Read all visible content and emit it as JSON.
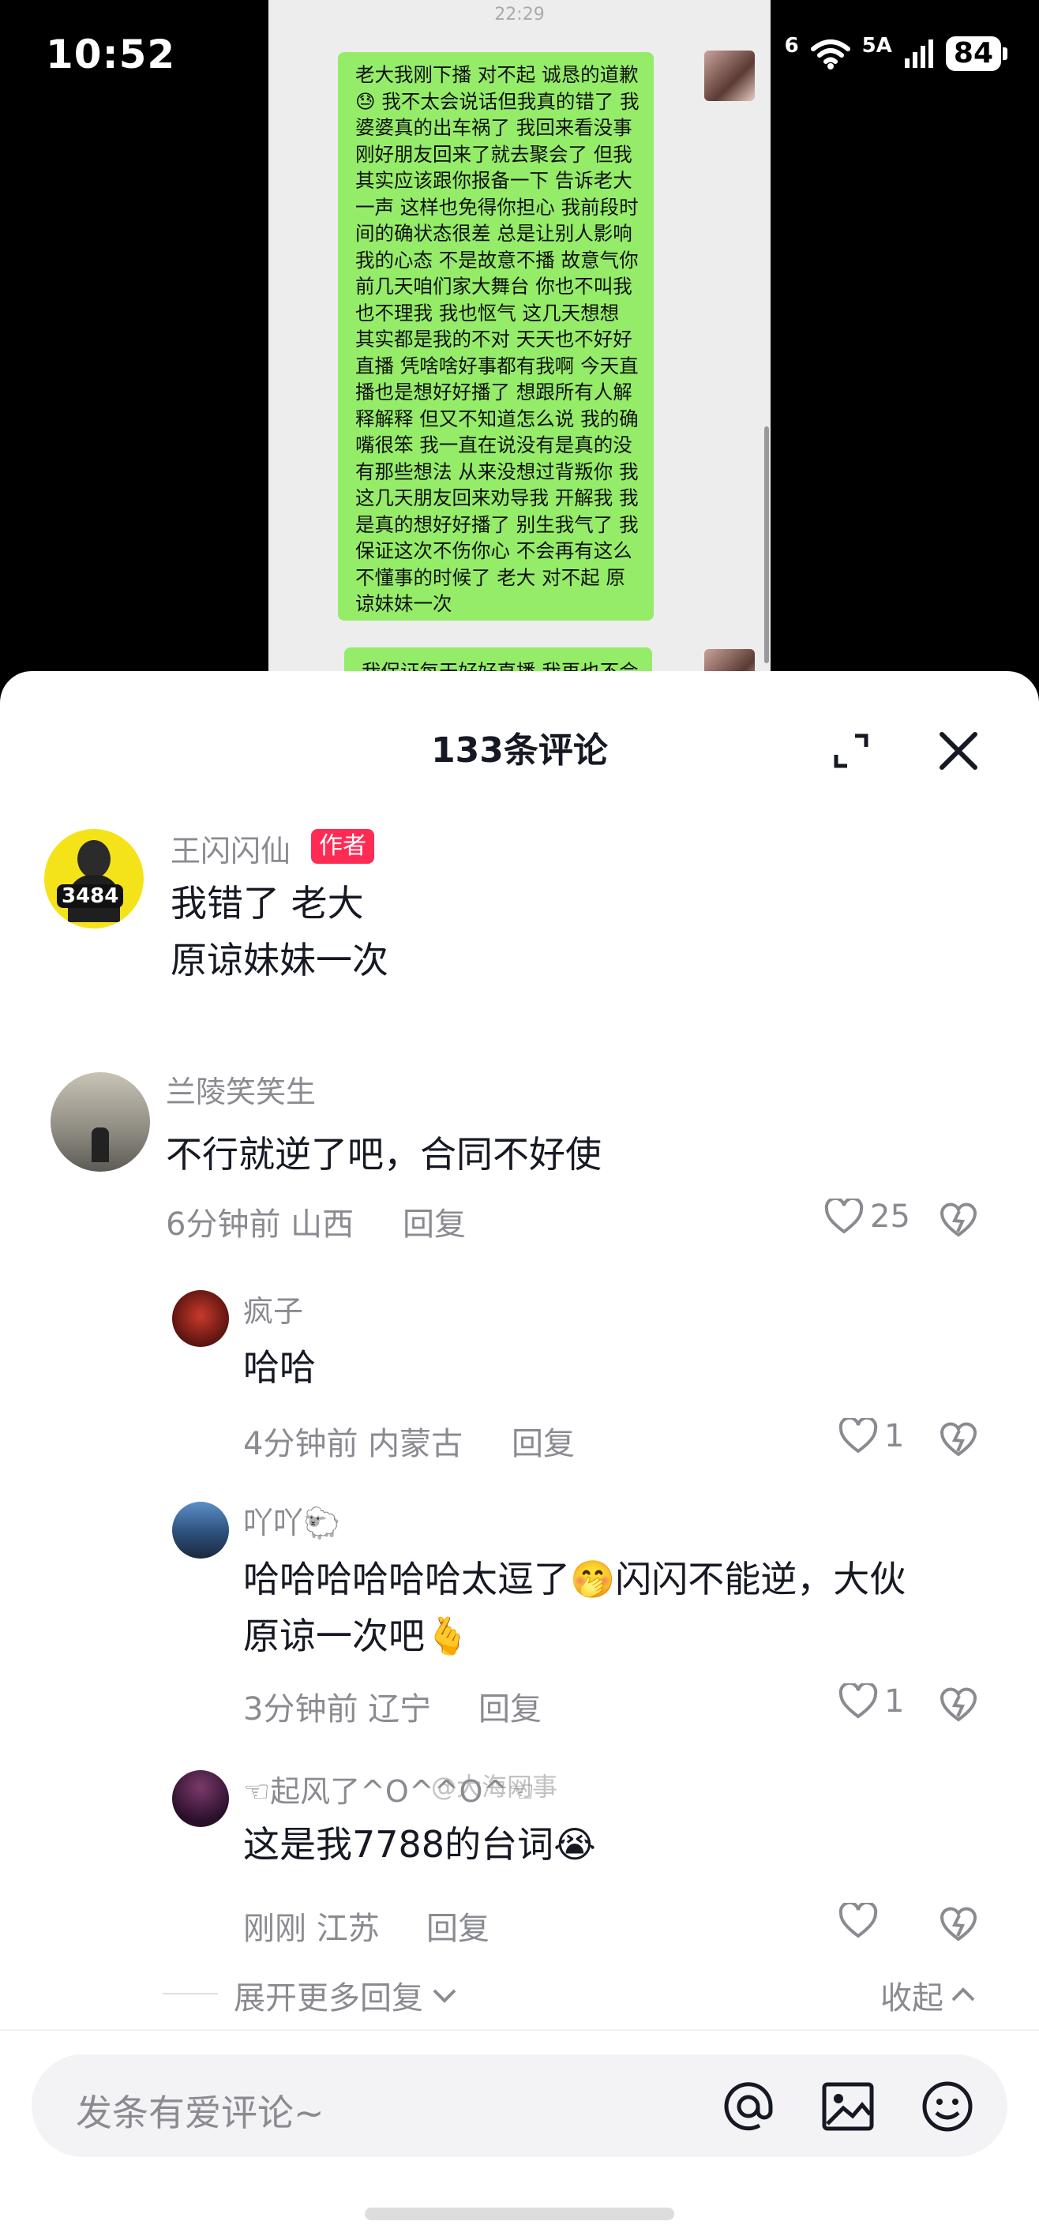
{
  "status": {
    "time": "10:52",
    "network": "6",
    "network2": "5A",
    "battery": "84"
  },
  "chat": {
    "time": "22:29",
    "message": "老大我刚下播 对不起 诚恳的道歉😓 我不太会说话但我真的错了 我婆婆真的出车祸了 我回来看没事刚好朋友回来了就去聚会了 但我其实应该跟你报备一下 告诉老大一声 这样也免得你担心 我前段时间的确状态很差 总是让别人影响我的心态 不是故意不播 故意气你前几天咱们家大舞台 你也不叫我也不理我 我也怄气 这几天想想 其实都是我的不对 天天也不好好直播 凭啥啥好事都有我啊 今天直播也是想好好播了 想跟所有人解释解释 但又不知道怎么说 我的确嘴很笨 我一直在说没有是真的没有那些想法 从来没想过背叛你 我这几天朋友回来劝导我 开解我 我是真的想好好播了 别生我气了 我保证这次不伤你心 不会再有这么不懂事的时候了 老大 对不起 原谅妹妹一次",
    "message2": "我保证每天好好直播 我再也不会"
  },
  "sheet": {
    "title": "133条评论"
  },
  "watermark": "@大海网事",
  "comments": [
    {
      "user": "王闪闪仙",
      "tag": "作者",
      "text": "我错了 老大\n原谅妹妹一次",
      "avatar_text": "3484"
    },
    {
      "user": "兰陵笑笑生",
      "text": "不行就逆了吧，合同不好使",
      "time": "6分钟前",
      "location": "山西",
      "reply": "回复",
      "likes": "25"
    }
  ],
  "replies": [
    {
      "user": "疯子",
      "text": "哈哈",
      "time": "4分钟前",
      "location": "内蒙古",
      "reply": "回复",
      "likes": "1"
    },
    {
      "user": "吖吖🐑",
      "text": "哈哈哈哈哈哈太逗了🤭闪闪不能逆，大伙\n原谅一次吧🫰",
      "time": "3分钟前",
      "location": "辽宁",
      "reply": "回复",
      "likes": "1"
    },
    {
      "user": "☜起风了^O^^O^☜",
      "text": "这是我7788的台词😭",
      "time": "刚刚",
      "location": "江苏",
      "reply": "回复",
      "likes": ""
    }
  ],
  "footer": {
    "more_replies": "展开更多回复",
    "collapse": "收起"
  },
  "input": {
    "placeholder": "发条有爱评论~"
  }
}
